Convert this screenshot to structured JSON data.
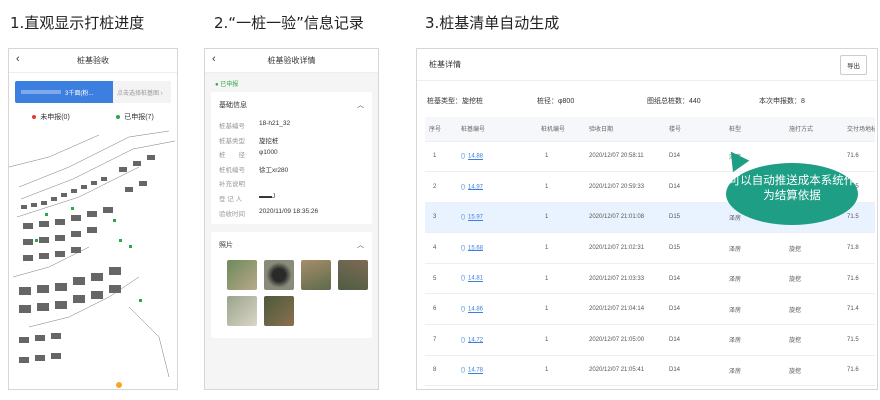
{
  "captions": [
    "1.直观显示打桩进度",
    "2.“一桩一验”信息记录",
    "3.桩基清单自动生成"
  ],
  "panel1": {
    "title": "桩基验收",
    "selected_label": "3千面(粉...",
    "hint": "点击选择桩基图 ›",
    "legend_unreported": "未申报(0)",
    "legend_reported": "已申报(7)",
    "colors": {
      "unreported": "#e53935",
      "reported": "#2ba84a",
      "accent": "#3b7fe0"
    }
  },
  "panel2": {
    "title": "桩基验收详情",
    "status": "● 已申报",
    "section_basic": "基础信息",
    "fields": [
      {
        "k": "桩基编号",
        "v": "18-h21_32"
      },
      {
        "k": "桩基类型",
        "v": "旋挖桩"
      },
      {
        "k": "桩　　径",
        "v": "φ1000"
      },
      {
        "k": "桩机编号",
        "v": "徐工xr280"
      },
      {
        "k": "补充说明",
        "v": ""
      },
      {
        "k": "登 记 人",
        "v": "▬▬J"
      },
      {
        "k": "验收时间",
        "v": "2020/11/09 18:35:26"
      }
    ],
    "section_photos": "照片"
  },
  "panel3": {
    "title": "桩基详情",
    "export": "导出",
    "summary": [
      "桩基类型：旋挖桩",
      "桩径：φ800",
      "图纸总桩数：440",
      "本次申报数：8"
    ],
    "columns": [
      "序号",
      "桩基编号",
      "桩机编号",
      "验收日期",
      "楼号",
      "桩型",
      "施打方式",
      "交付场地标"
    ],
    "rows": [
      [
        "1",
        "14.88",
        "1",
        "2020/12/07 20:58:11",
        "D14",
        "泽房",
        "",
        "71.6"
      ],
      [
        "2",
        "14.97",
        "1",
        "2020/12/07 20:59:33",
        "D14",
        "泽房",
        "",
        "71.5"
      ],
      [
        "3",
        "15.97",
        "1",
        "2020/12/07 21:01:08",
        "D15",
        "泽房",
        "",
        "71.5"
      ],
      [
        "4",
        "15.68",
        "1",
        "2020/12/07 21:02:31",
        "D15",
        "泽房",
        "旋挖",
        "71.8"
      ],
      [
        "5",
        "14.81",
        "1",
        "2020/12/07 21:03:33",
        "D14",
        "泽房",
        "旋挖",
        "71.6"
      ],
      [
        "6",
        "14.86",
        "1",
        "2020/12/07 21:04:14",
        "D14",
        "泽房",
        "旋挖",
        "71.4"
      ],
      [
        "7",
        "14.72",
        "1",
        "2020/12/07 21:05:00",
        "D14",
        "泽房",
        "旋挖",
        "71.5"
      ],
      [
        "8",
        "14.78",
        "1",
        "2020/12/07 21:05:41",
        "D14",
        "泽房",
        "旋挖",
        "71.6"
      ]
    ],
    "callout": "可以自动推送成本系统作为结算依据"
  }
}
